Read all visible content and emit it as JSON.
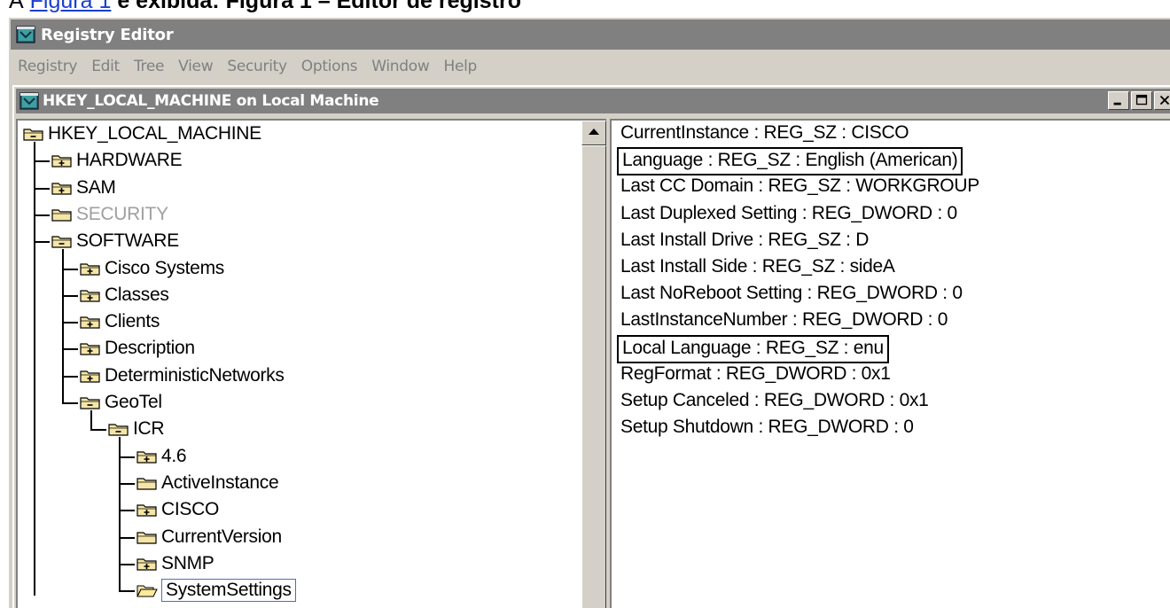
{
  "caption": {
    "lead": "A",
    "link": "Figura 1",
    "text": "é exibida: Figura 1 – Editor de registro"
  },
  "window": {
    "title": "Registry Editor"
  },
  "menu": [
    "Registry",
    "Edit",
    "Tree",
    "View",
    "Security",
    "Options",
    "Window",
    "Help"
  ],
  "child_window": {
    "title": "HKEY_LOCAL_MACHINE on Local Machine"
  },
  "tree": [
    {
      "label": "HKEY_LOCAL_MACHINE",
      "icon": "folder-minus-icon",
      "dim": false
    },
    {
      "label": "HARDWARE",
      "icon": "folder-plus-icon",
      "dim": false
    },
    {
      "label": "SAM",
      "icon": "folder-plus-icon",
      "dim": false
    },
    {
      "label": "SECURITY",
      "icon": "folder-icon",
      "dim": true
    },
    {
      "label": "SOFTWARE",
      "icon": "folder-minus-icon",
      "dim": false
    },
    {
      "label": "Cisco Systems",
      "icon": "folder-plus-icon",
      "dim": false
    },
    {
      "label": "Classes",
      "icon": "folder-plus-icon",
      "dim": false
    },
    {
      "label": "Clients",
      "icon": "folder-plus-icon",
      "dim": false
    },
    {
      "label": "Description",
      "icon": "folder-plus-icon",
      "dim": false
    },
    {
      "label": "DeterministicNetworks",
      "icon": "folder-plus-icon",
      "dim": false
    },
    {
      "label": "GeoTel",
      "icon": "folder-minus-icon",
      "dim": false
    },
    {
      "label": "ICR",
      "icon": "folder-minus-icon",
      "dim": false
    },
    {
      "label": "4.6",
      "icon": "folder-plus-icon",
      "dim": false
    },
    {
      "label": "ActiveInstance",
      "icon": "folder-icon",
      "dim": false
    },
    {
      "label": "CISCO",
      "icon": "folder-plus-icon",
      "dim": false
    },
    {
      "label": "CurrentVersion",
      "icon": "folder-icon",
      "dim": false
    },
    {
      "label": "SNMP",
      "icon": "folder-plus-icon",
      "dim": false
    },
    {
      "label": "SystemSettings",
      "icon": "folder-open-icon",
      "dim": false
    }
  ],
  "values": [
    {
      "text": "CurrentInstance : REG_SZ : CISCO",
      "boxed": false
    },
    {
      "text": "Language : REG_SZ : English (American)",
      "boxed": true
    },
    {
      "text": "Last CC Domain : REG_SZ : WORKGROUP",
      "boxed": false
    },
    {
      "text": "Last Duplexed Setting : REG_DWORD : 0",
      "boxed": false
    },
    {
      "text": "Last Install Drive : REG_SZ : D",
      "boxed": false
    },
    {
      "text": "Last Install Side : REG_SZ : sideA",
      "boxed": false
    },
    {
      "text": "Last NoReboot Setting : REG_DWORD : 0",
      "boxed": false
    },
    {
      "text": "LastInstanceNumber : REG_DWORD : 0",
      "boxed": false
    },
    {
      "text": "Local Language : REG_SZ : enu",
      "boxed": true
    },
    {
      "text": "RegFormat : REG_DWORD : 0x1",
      "boxed": false
    },
    {
      "text": "Setup Canceled : REG_DWORD : 0x1",
      "boxed": false
    },
    {
      "text": "Setup Shutdown : REG_DWORD : 0",
      "boxed": false
    }
  ],
  "colors": {
    "title_bar_inactive": "#808080",
    "window_face": "#d4d0c8",
    "folder_fill": "#f5e6a8",
    "selection_outline": "#4a6fc0",
    "dim_text": "#a0a0a0"
  }
}
